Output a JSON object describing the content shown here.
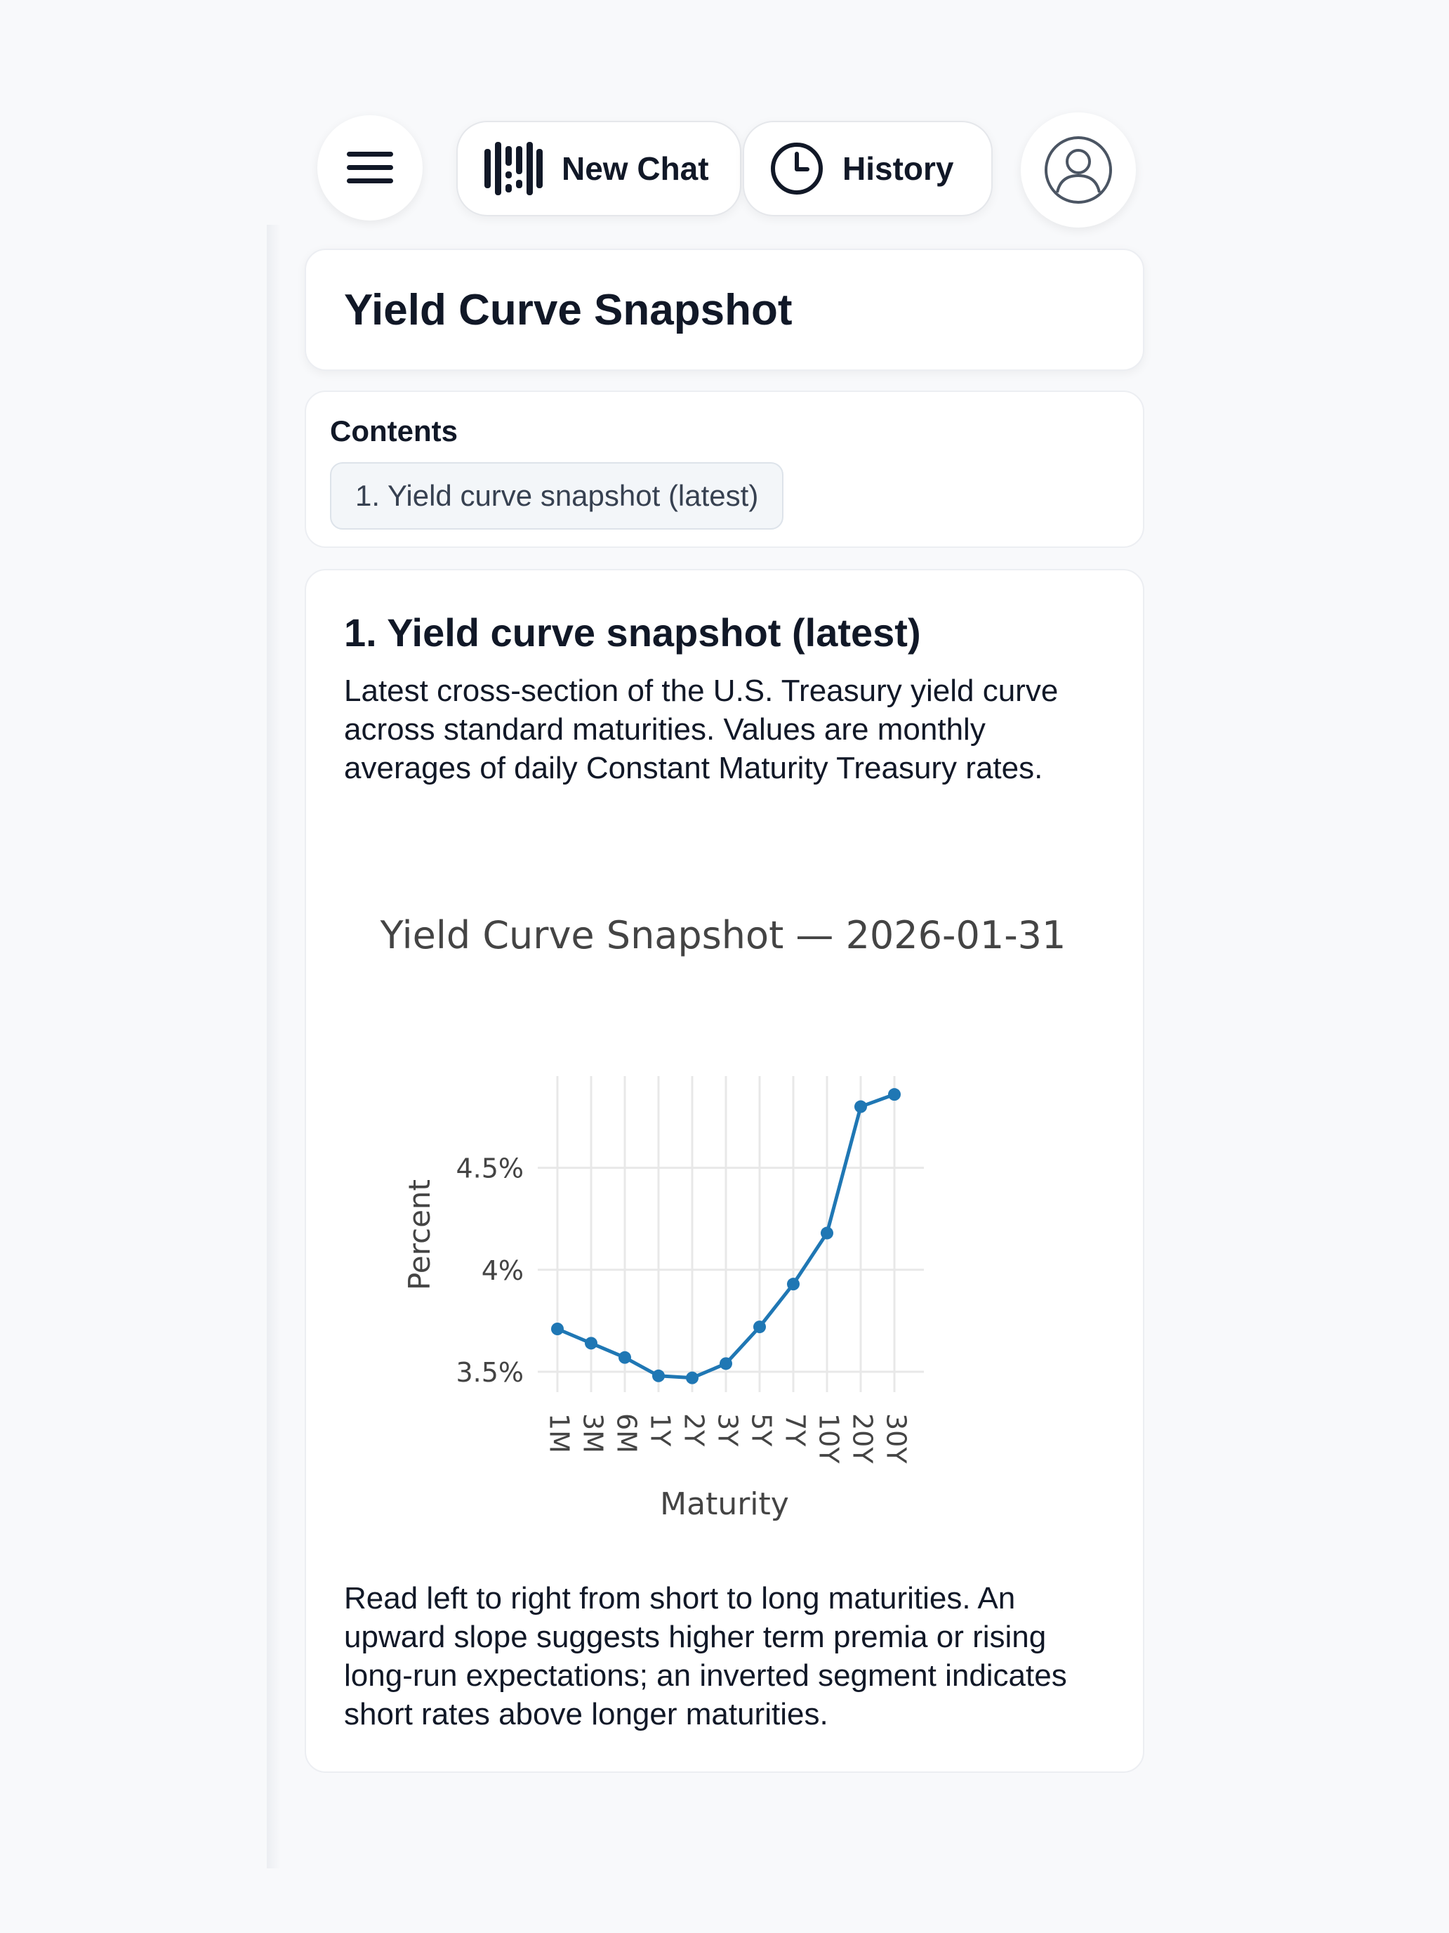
{
  "header": {
    "new_chat_label": "New Chat",
    "history_label": "History"
  },
  "page": {
    "title": "Yield Curve Snapshot"
  },
  "contents": {
    "label": "Contents",
    "items": [
      "1. Yield curve snapshot (latest)"
    ]
  },
  "section": {
    "title": "1. Yield curve snapshot (latest)",
    "intro": "Latest cross-section of the U.S. Treasury yield curve across standard maturities. Values are monthly averages of daily Constant Maturity Treasury rates.",
    "outro": "Read left to right from short to long maturities. An upward slope suggests higher term premia or rising long-run expectations; an inverted segment indicates short rates above longer maturities."
  },
  "colors": {
    "series": "#1f77b4",
    "grid": "#e8e8e8",
    "text": "#444444"
  },
  "chart_data": {
    "type": "line",
    "title": "Yield Curve Snapshot — 2026-01-31",
    "xlabel": "Maturity",
    "ylabel": "Percent",
    "categories": [
      "1M",
      "3M",
      "6M",
      "1Y",
      "2Y",
      "3Y",
      "5Y",
      "7Y",
      "10Y",
      "20Y",
      "30Y"
    ],
    "values": [
      3.71,
      3.64,
      3.57,
      3.48,
      3.47,
      3.54,
      3.72,
      3.93,
      4.18,
      4.8,
      4.86
    ],
    "yticks": [
      3.5,
      4.0,
      4.5
    ],
    "ytick_labels": [
      "3.5%",
      "4%",
      "4.5%"
    ],
    "ylim": [
      3.4,
      4.95
    ],
    "grid": true,
    "markers": true
  }
}
